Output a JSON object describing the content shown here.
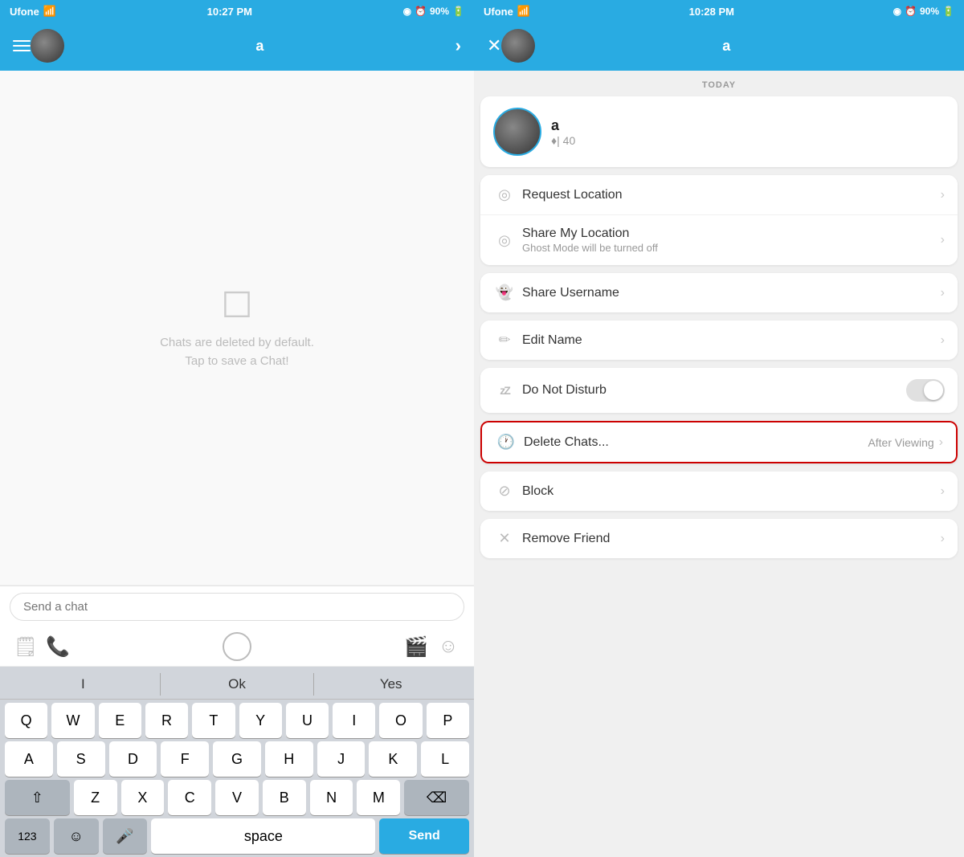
{
  "left": {
    "statusBar": {
      "carrier": "Ufone",
      "time": "10:27 PM",
      "battery": "90%"
    },
    "header": {
      "username": "a",
      "chevron": "›"
    },
    "chat": {
      "emptyIcon": "☐",
      "emptyLine1": "Chats are deleted by default.",
      "emptyLine2": "Tap to save a Chat!"
    },
    "input": {
      "placeholder": "Send a chat"
    },
    "keyboard": {
      "suggestions": [
        "I",
        "Ok",
        "Yes"
      ],
      "row1": [
        "Q",
        "W",
        "E",
        "R",
        "T",
        "Y",
        "U",
        "I",
        "O",
        "P"
      ],
      "row2": [
        "A",
        "S",
        "D",
        "F",
        "G",
        "H",
        "J",
        "K",
        "L"
      ],
      "row3": [
        "Z",
        "X",
        "C",
        "V",
        "B",
        "N",
        "M"
      ],
      "bottom": {
        "numbers": "123",
        "emoji": "☺",
        "mic": "🎤",
        "space": "space",
        "send": "Send"
      }
    }
  },
  "right": {
    "statusBar": {
      "carrier": "Ufone",
      "time": "10:28 PM",
      "battery": "90%"
    },
    "header": {
      "username": "a"
    },
    "today": "TODAY",
    "profile": {
      "name": "a",
      "score": "♦| 40"
    },
    "menu": {
      "requestLocation": {
        "label": "Request Location",
        "icon": "📍"
      },
      "shareLocation": {
        "label": "Share My Location",
        "sublabel": "Ghost Mode will be turned off",
        "icon": "📍"
      },
      "shareUsername": {
        "label": "Share Username",
        "icon": "👻"
      },
      "editName": {
        "label": "Edit Name",
        "icon": "✏"
      },
      "doNotDisturb": {
        "label": "Do Not Disturb",
        "icon": "💤"
      },
      "deleteChats": {
        "label": "Delete Chats...",
        "value": "After Viewing",
        "icon": "🕐"
      },
      "block": {
        "label": "Block",
        "icon": "🚫"
      },
      "removeFriend": {
        "label": "Remove Friend",
        "icon": "✕"
      }
    }
  }
}
